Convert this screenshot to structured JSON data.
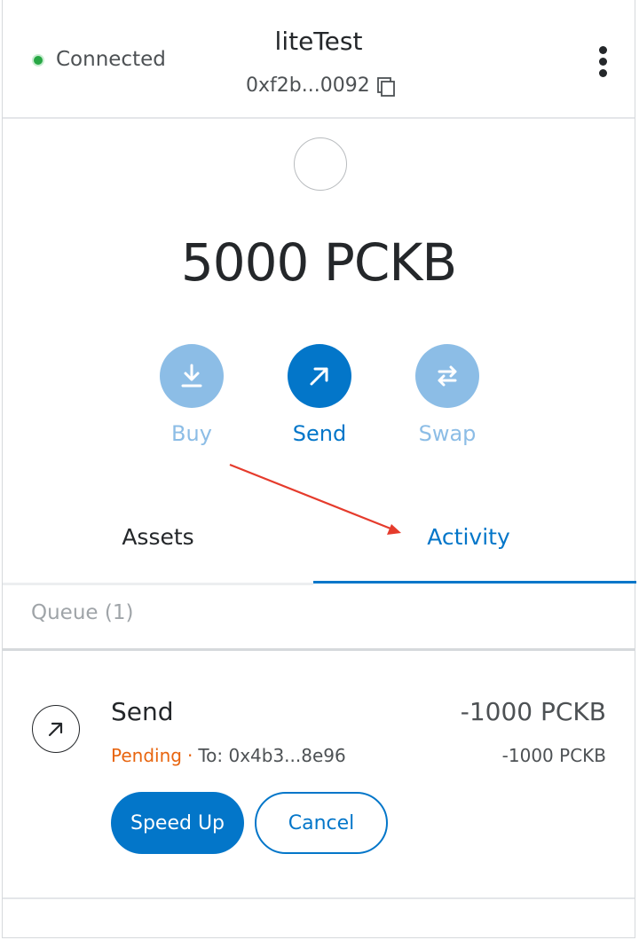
{
  "header": {
    "status": "Connected",
    "account_name": "liteTest",
    "account_address": "0xf2b...0092"
  },
  "balance": {
    "text": "5000 PCKB"
  },
  "actions": {
    "buy": "Buy",
    "send": "Send",
    "swap": "Swap"
  },
  "tabs": {
    "assets": "Assets",
    "activity": "Activity",
    "active": "activity"
  },
  "queue": {
    "label": "Queue (1)"
  },
  "transaction": {
    "title": "Send",
    "amount": "-1000 PCKB",
    "status": "Pending",
    "separator": "·",
    "recipient": "To: 0x4b3...8e96",
    "secondary_amount": "-1000 PCKB",
    "speed_up_label": "Speed Up",
    "cancel_label": "Cancel"
  },
  "colors": {
    "accent": "#0376c9",
    "accent_light": "#8cbde6",
    "pending": "#e8650f",
    "connected": "#28a745",
    "annotation_arrow": "#e53b2c"
  },
  "icons": {
    "status": "green-dot-icon",
    "copy": "copy-icon",
    "menu": "kebab-menu-icon",
    "avatar": "identicon",
    "buy": "download-icon",
    "send": "arrow-up-right-icon",
    "swap": "swap-arrows-icon",
    "transaction": "arrow-up-right-icon"
  }
}
